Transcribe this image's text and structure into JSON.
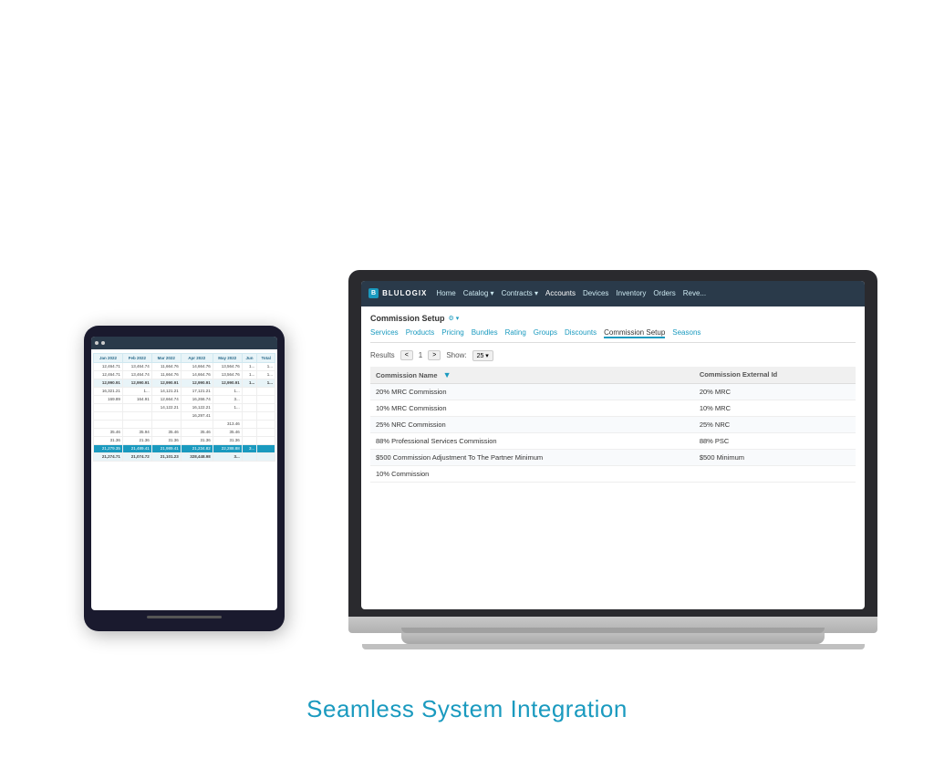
{
  "title": "Seamless System Integration",
  "laptop": {
    "logo": "BLULOGIX",
    "logo_icon": "B",
    "nav_items": [
      "Home",
      "Catalog ▾",
      "Contracts ▾",
      "Accounts",
      "Devices",
      "Inventory",
      "Orders",
      "Reve..."
    ],
    "page_title": "Commission Setup",
    "sub_nav": [
      "Services",
      "Products",
      "Pricing",
      "Bundles",
      "Rating",
      "Groups",
      "Discounts",
      "Commission Setup",
      "Seasons"
    ],
    "active_sub_nav": "Commission Setup",
    "toolbar": {
      "results_label": "Results",
      "prev_btn": "<",
      "page": "1",
      "next_btn": ">",
      "show_label": "Show:",
      "show_value": "25 ▾"
    },
    "table": {
      "columns": [
        "Commission Name",
        "Commission External Id"
      ],
      "rows": [
        [
          "20% MRC Commission",
          "20% MRC"
        ],
        [
          "10% MRC Commission",
          "10% MRC"
        ],
        [
          "25% NRC Commission",
          "25% NRC"
        ],
        [
          "88% Professional Services Commission",
          "88% PSC"
        ],
        [
          "$500 Commission Adjustment To The Partner Minimum",
          "$500 Minimum"
        ],
        [
          "10% Commission",
          ""
        ]
      ]
    }
  },
  "tablet": {
    "columns": [
      "Jan 2022",
      "Feb 2022",
      "Mar 2022",
      "Apr 2022",
      "May 2022",
      "Jun",
      "Total"
    ],
    "rows": [
      [
        "12,464.71",
        "13,464.74",
        "11,664.76",
        "14,664.76",
        "13,564.76",
        "1..."
      ],
      [
        "12,464.71",
        "13,464.74",
        "11,664.76",
        "14,664.76",
        "13,564.76",
        "1..."
      ],
      [
        "12,990.91",
        "12,990.91",
        "12,990.91",
        "12,990.91",
        "12,990.91",
        "1..."
      ],
      [
        "16,321.21",
        "1...",
        "14,121.21",
        "17,121.21",
        "1..."
      ],
      [
        "169.89",
        "164.91",
        "12,664.74",
        "16,266.74",
        "3..."
      ],
      [
        "",
        "",
        "14,122.21",
        "16,122.21",
        "1..."
      ],
      [
        "",
        "",
        "",
        "16,297.41",
        ""
      ],
      [
        "",
        "",
        "",
        "",
        "313.46"
      ],
      [
        "35.46",
        "35.94",
        "35.46",
        "35.46",
        "35.46"
      ],
      [
        "31.36",
        "21.36",
        "31.36",
        "31.36",
        "31.36"
      ],
      [
        "21,279.35",
        "21,489.41",
        "21,989.41",
        "21,234.82",
        "22,288.88",
        "3..."
      ],
      [
        "21,274.71",
        "21,074.72",
        "21,101.23",
        "328,448.98",
        "3..."
      ]
    ]
  }
}
